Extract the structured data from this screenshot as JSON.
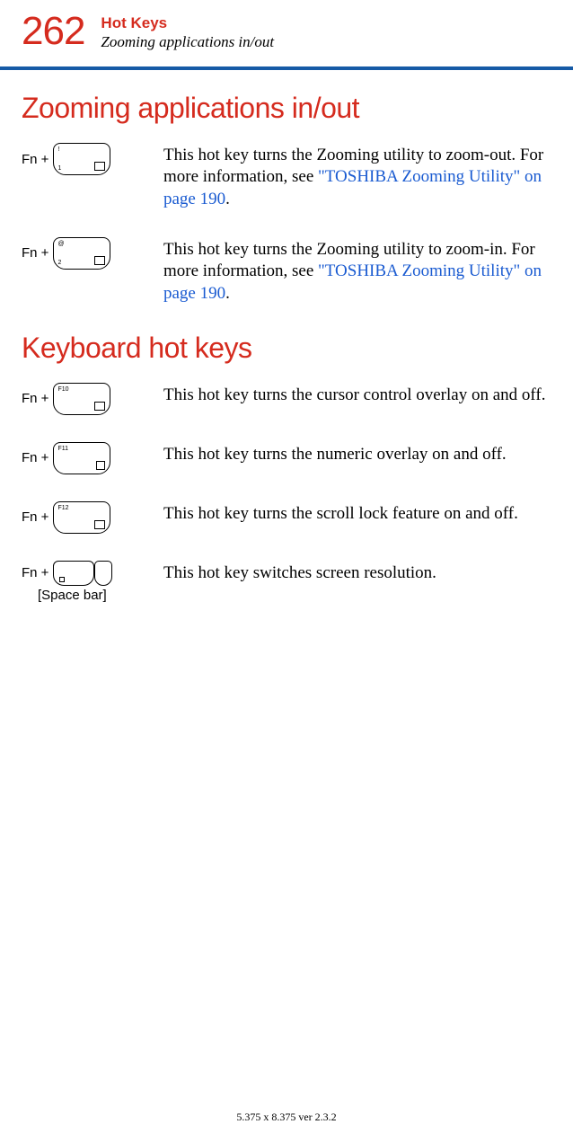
{
  "header": {
    "page_number": "262",
    "chapter": "Hot Keys",
    "section": "Zooming applications in/out"
  },
  "sections": {
    "zooming": {
      "heading": "Zooming applications in/out",
      "rows": [
        {
          "fn": "Fn + ",
          "key_tl": "!",
          "key_bl": "1",
          "key_br": "",
          "desc_pre": "This hot key turns the Zooming utility to zoom-out. For more information, see ",
          "link": "\"TOSHIBA Zooming Utility\" on page 190",
          "desc_post": "."
        },
        {
          "fn": "Fn + ",
          "key_tl": "@",
          "key_bl": "2",
          "key_br": "",
          "desc_pre": "This hot key turns the Zooming utility to zoom-in. For more information, see ",
          "link": "\"TOSHIBA Zooming Utility\" on page 190",
          "desc_post": "."
        }
      ]
    },
    "keyboard": {
      "heading": "Keyboard hot keys",
      "rows": [
        {
          "fn": "Fn + ",
          "key_tl": "F10",
          "desc": "This hot key turns the cursor control overlay on and off."
        },
        {
          "fn": "Fn + ",
          "key_tl": "F11",
          "desc": "This hot key turns the numeric overlay on and off."
        },
        {
          "fn": "Fn + ",
          "key_tl": "F12",
          "desc": "This hot key turns the scroll lock feature on and off."
        },
        {
          "fn": "Fn + ",
          "space_label": "[Space bar]",
          "desc": "This hot key switches screen resolution."
        }
      ]
    }
  },
  "footer": "5.375 x 8.375 ver 2.3.2"
}
